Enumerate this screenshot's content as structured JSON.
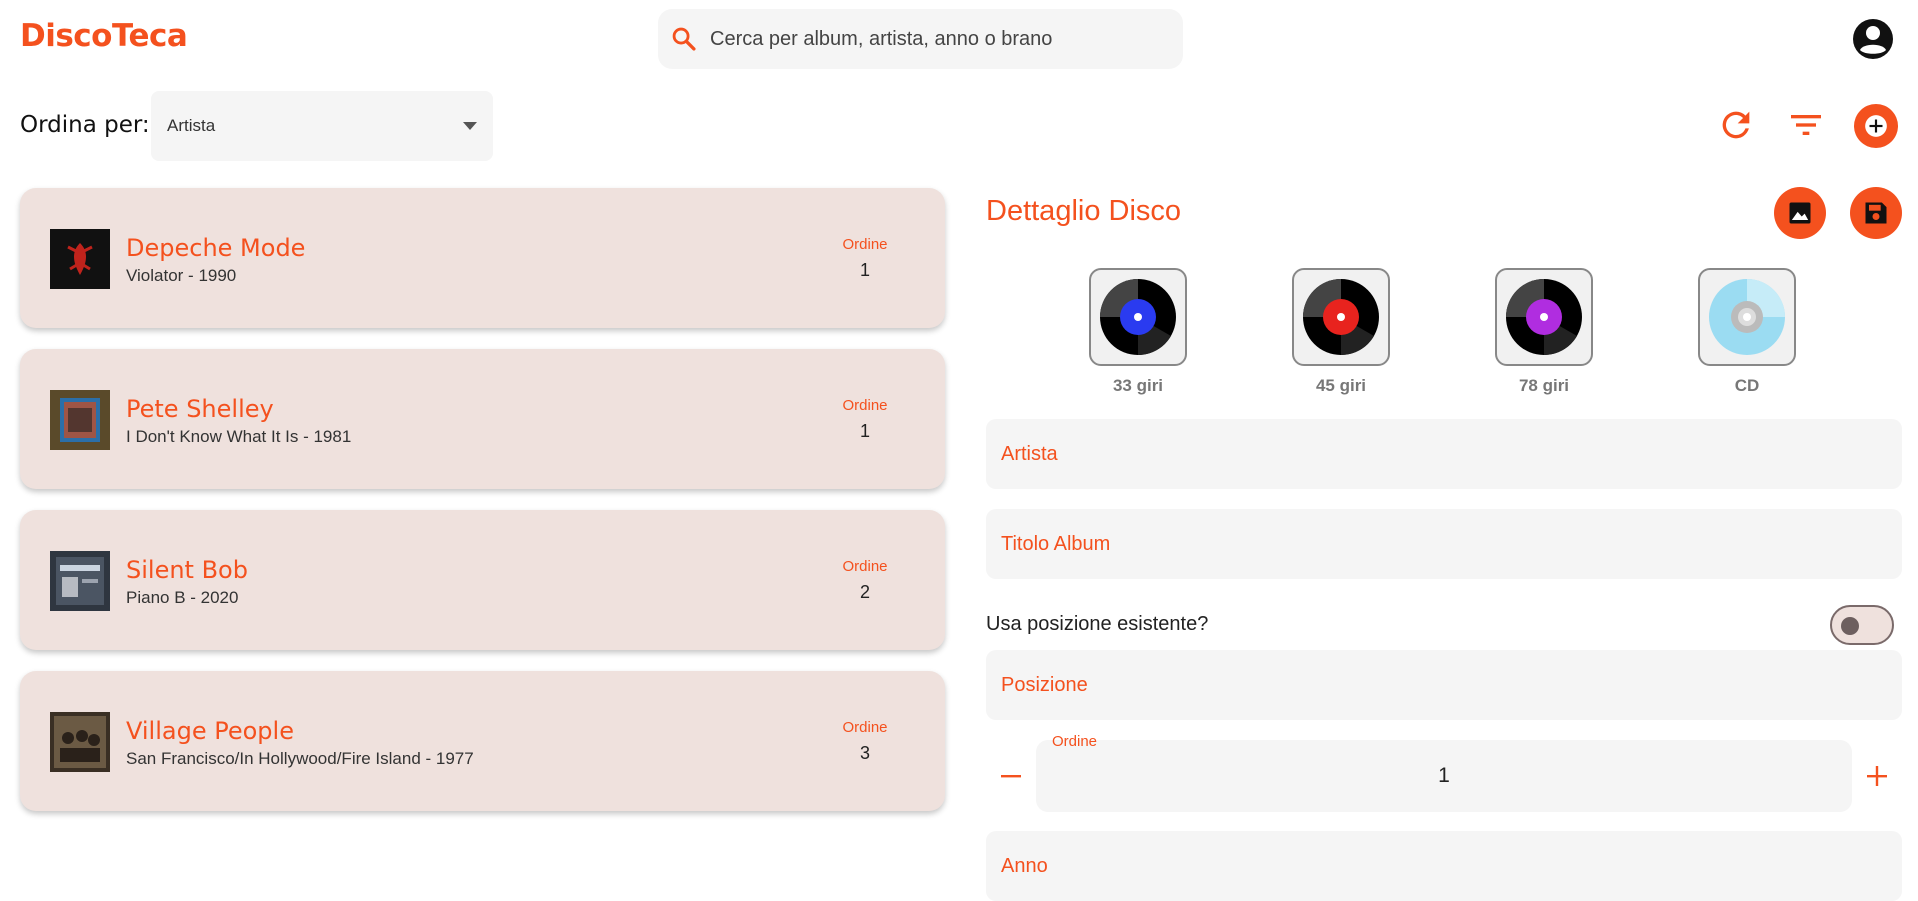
{
  "app": {
    "title": "DiscoTeca"
  },
  "search": {
    "placeholder": "Cerca per album, artista, anno o brano"
  },
  "sort": {
    "label": "Ordina per:",
    "selected": "Artista"
  },
  "toolbar": {
    "icons": [
      "refresh-icon",
      "filter-icon",
      "add-circle-icon"
    ]
  },
  "records": [
    {
      "artist": "Depeche Mode",
      "subtitle": "Violator - 1990",
      "order_label": "Ordine",
      "order": "1",
      "cover": "violator-cover"
    },
    {
      "artist": "Pete Shelley",
      "subtitle": "I Don't Know What It Is - 1981",
      "order_label": "Ordine",
      "order": "1",
      "cover": "shelley-cover"
    },
    {
      "artist": "Silent Bob",
      "subtitle": "Piano B - 2020",
      "order_label": "Ordine",
      "order": "2",
      "cover": "silentbob-cover"
    },
    {
      "artist": "Village People",
      "subtitle": "San Francisco/In Hollywood/Fire Island - 1977",
      "order_label": "Ordine",
      "order": "3",
      "cover": "villagepeople-cover"
    }
  ],
  "detail": {
    "title": "Dettaglio Disco",
    "formats": [
      {
        "label": "33 giri",
        "color": "#2a3bf0"
      },
      {
        "label": "45 giri",
        "color": "#e8231e"
      },
      {
        "label": "78 giri",
        "color": "#b02de0"
      },
      {
        "label": "CD",
        "color": "#9bdcf2"
      }
    ],
    "fields": {
      "artist": "Artista",
      "album": "Titolo Album",
      "position": "Posizione",
      "year": "Anno"
    },
    "toggle_label": "Usa posizione esistente?",
    "toggle_on": false,
    "order": {
      "label": "Ordine",
      "value": "1"
    }
  },
  "colors": {
    "accent": "#f4511e",
    "card_bg": "#efe1dd",
    "field_bg": "#f5f5f5"
  }
}
